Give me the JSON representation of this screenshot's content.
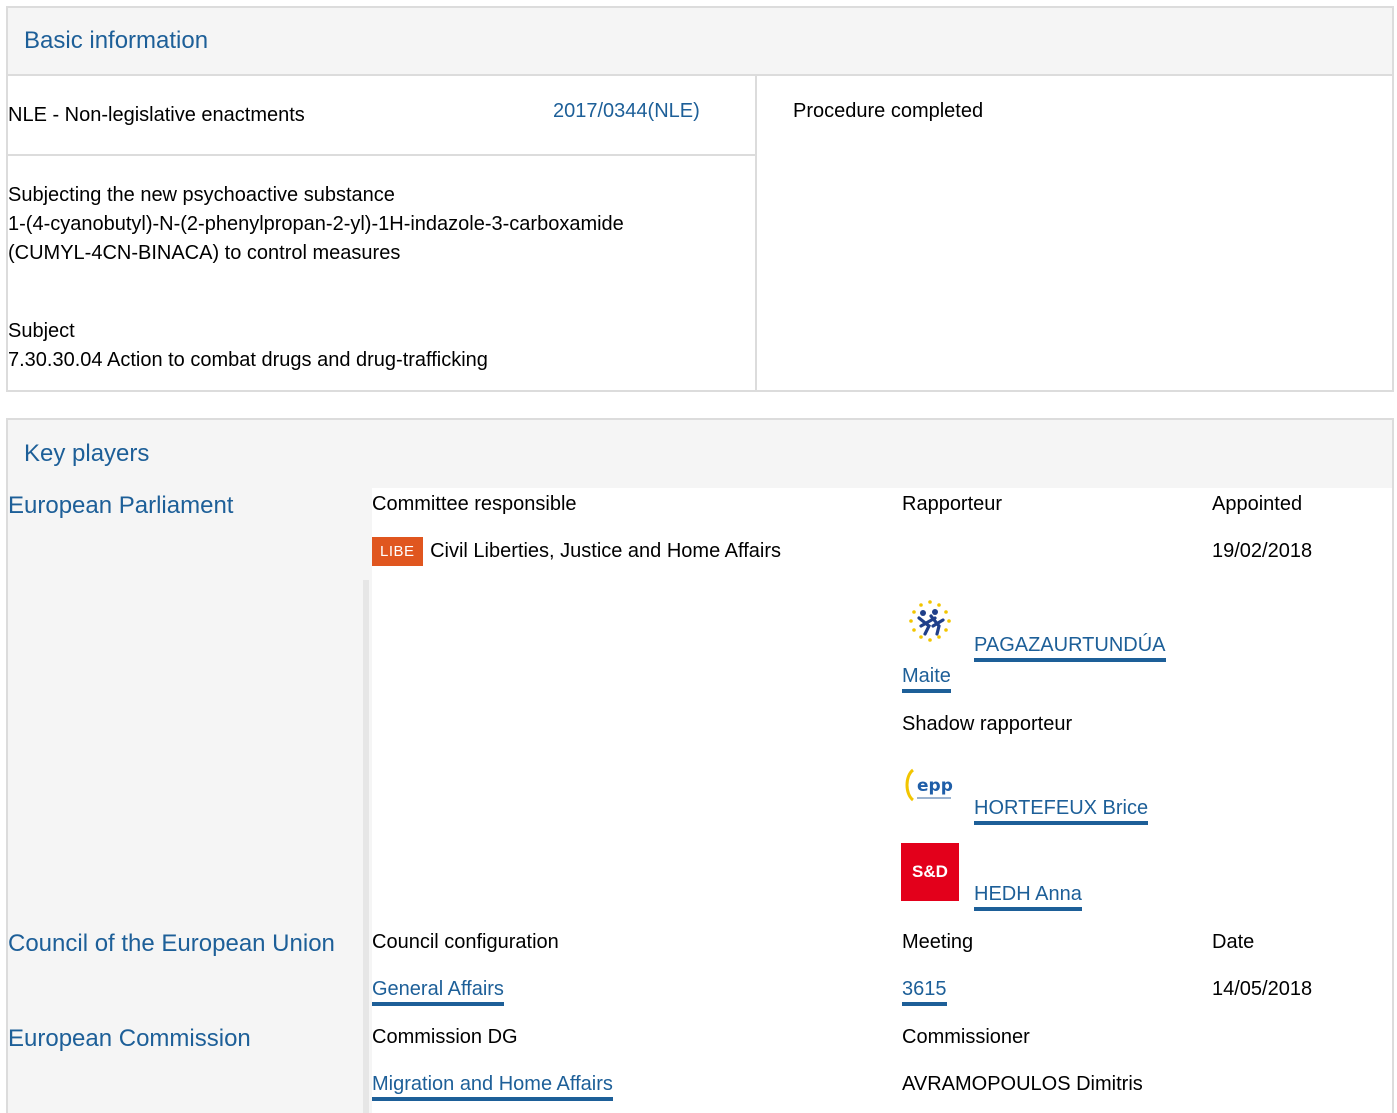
{
  "basic": {
    "heading": "Basic information",
    "procedure_type": "NLE - Non-legislative enactments",
    "reference": "2017/0344(NLE)",
    "title_lines": [
      "Subjecting the new psychoactive substance",
      "1-(4-cyanobutyl)-N-(2-phenylpropan-2-yl)-1H-indazole-3-carboxamide",
      "(CUMYL-4CN-BINACA) to control measures"
    ],
    "subject_label": "Subject",
    "subject_value": "7.30.30.04 Action to combat drugs and drug-trafficking",
    "status": "Procedure completed"
  },
  "players": {
    "heading": "Key players",
    "ep": {
      "name": "European Parliament",
      "col_committee": "Committee responsible",
      "col_rapporteur": "Rapporteur",
      "col_appointed": "Appointed",
      "committee_badge": "LIBE",
      "committee_name": "Civil Liberties, Justice and Home Affairs",
      "appointed_date": "19/02/2018",
      "rapporteur_line1": "PAGAZAURTUNDÚA",
      "rapporteur_line2": "Maite",
      "shadow_label": "Shadow rapporteur",
      "shadow1": "HORTEFEUX Brice",
      "shadow2": "HEDH Anna",
      "logo_sd_text": "S&D",
      "logo_epp_text": "epp"
    },
    "council": {
      "name": "Council of the European Union",
      "col_config": "Council configuration",
      "col_meeting": "Meeting",
      "col_date": "Date",
      "config": "General Affairs",
      "meeting": "3615",
      "date": "14/05/2018"
    },
    "commission": {
      "name": "European Commission",
      "col_dg": "Commission DG",
      "col_commissioner": "Commissioner",
      "dg": "Migration and Home Affairs",
      "commissioner": "AVRAMOPOULOS Dimitris"
    }
  },
  "colors": {
    "link": "#1d5f98",
    "libe_badge": "#e0561f",
    "panel_bg": "#f5f5f5",
    "border": "#dcdcdc",
    "sd_red": "#e3001b",
    "epp_blue": "#1f5ea8"
  }
}
